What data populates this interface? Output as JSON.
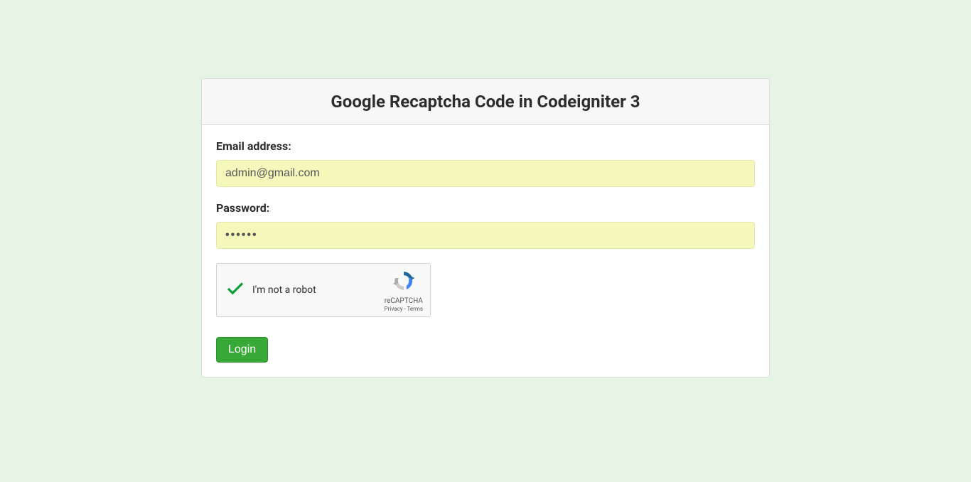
{
  "header": {
    "title": "Google Recaptcha Code in Codeigniter 3"
  },
  "form": {
    "email": {
      "label": "Email address:",
      "value": "admin@gmail.com"
    },
    "password": {
      "label": "Password:",
      "value": "••••••"
    },
    "recaptcha": {
      "label": "I'm not a robot",
      "brand": "reCAPTCHA",
      "privacy": "Privacy",
      "separator": " - ",
      "terms": "Terms"
    },
    "submit": {
      "label": "Login"
    }
  }
}
